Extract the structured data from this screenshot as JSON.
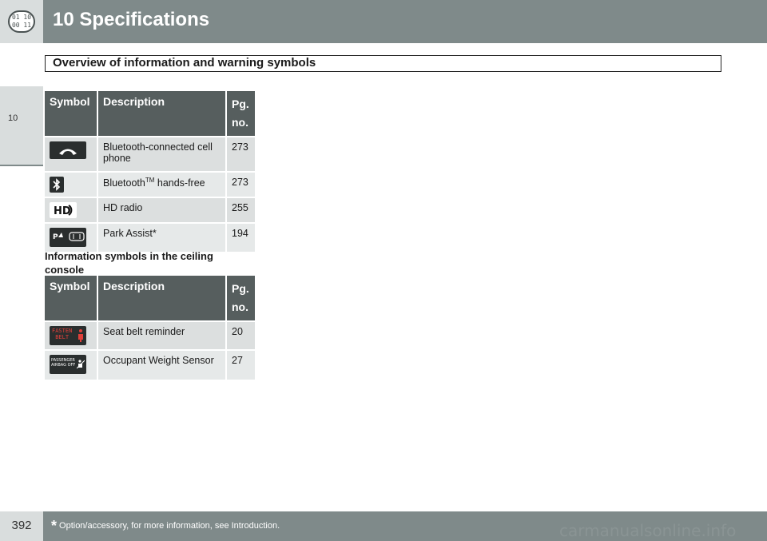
{
  "header": {
    "chapter_title": "10  Specifications",
    "icon_text_top": "01 10",
    "icon_text_bottom": "00 11"
  },
  "side_tab": {
    "chapter_number": "10"
  },
  "section": {
    "title": "Overview of information and warning symbols"
  },
  "table1": {
    "headers": {
      "symbol": "Symbol",
      "description": "Description",
      "page_line1": "Pg.",
      "page_line2": "no."
    },
    "rows": [
      {
        "icon": "phone-handset-icon",
        "description": "Bluetooth-connected cell phone",
        "page": "273"
      },
      {
        "icon": "bluetooth-icon",
        "description_main": "Bluetooth",
        "description_sup": "TM",
        "description_rest": " hands-free",
        "page": "273"
      },
      {
        "icon": "hd-radio-icon",
        "description": "HD radio",
        "page": "255"
      },
      {
        "icon": "park-assist-icon",
        "description": "Park Assist*",
        "page": "194"
      }
    ]
  },
  "subheading": "Information symbols in the ceiling console",
  "table2": {
    "headers": {
      "symbol": "Symbol",
      "description": "Description",
      "page_line1": "Pg.",
      "page_line2": "no."
    },
    "rows": [
      {
        "icon": "fasten-belt-icon",
        "icon_text_line1": "FASTEN",
        "icon_text_line2": "BELT",
        "description": "Seat belt reminder",
        "page": "20"
      },
      {
        "icon": "passenger-airbag-off-icon",
        "icon_text_line1": "PASSENGER",
        "icon_text_line2": "AIRBAG  OFF",
        "description": "Occupant Weight Sensor",
        "page": "27"
      }
    ]
  },
  "footer": {
    "page_number": "392",
    "footnote_mark": "*",
    "footnote_text": "Option/accessory, for more information, see Introduction."
  },
  "watermark": "carmanualsonline.info",
  "colors": {
    "header_band": "#7f8a8a",
    "table_header": "#565e5e",
    "row_light": "#e6e9e9",
    "warning_red": "#e0403a"
  }
}
